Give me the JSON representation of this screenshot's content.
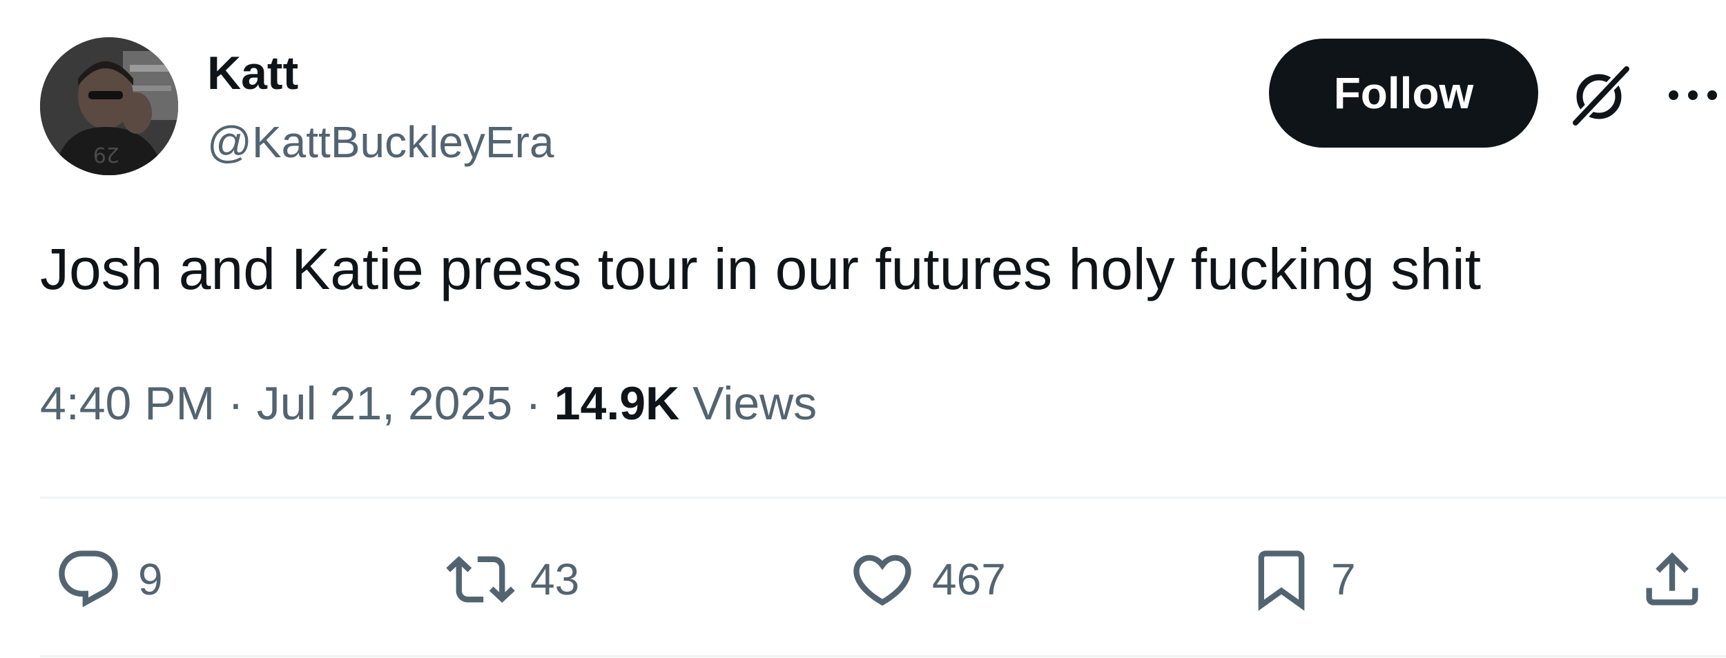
{
  "author": {
    "display_name": "Katt",
    "handle": "@KattBuckleyEra"
  },
  "follow_label": "Follow",
  "tweet": {
    "text": "Josh and Katie press tour in our futures holy fucking shit",
    "time": "4:40 PM",
    "separator": "·",
    "date": "Jul 21, 2025",
    "views_count": "14.9K",
    "views_label": "Views"
  },
  "actions": {
    "reply_count": "9",
    "retweet_count": "43",
    "like_count": "467",
    "bookmark_count": "7"
  },
  "icons": {
    "grok": "grok-icon",
    "more": "more-icon",
    "reply": "reply-icon",
    "retweet": "retweet-icon",
    "like": "heart-icon",
    "bookmark": "bookmark-icon",
    "share": "share-icon"
  },
  "colors": {
    "text_primary": "#0f1419",
    "text_secondary": "#536471",
    "button_bg": "#0f1419",
    "divider": "#eff3f4"
  }
}
